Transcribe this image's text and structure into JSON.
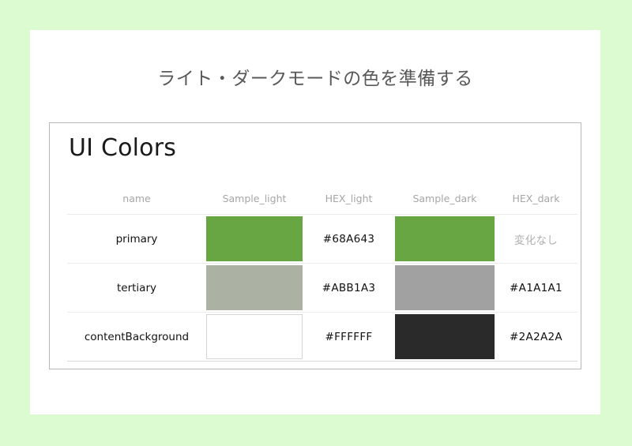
{
  "slide": {
    "title": "ライト・ダークモードの色を準備する",
    "background_color": "#dcfbd0",
    "card_color": "#ffffff"
  },
  "table": {
    "heading": "UI Colors",
    "columns": [
      {
        "key": "name",
        "label": "name"
      },
      {
        "key": "sample_light",
        "label": "Sample_light"
      },
      {
        "key": "hex_light",
        "label": "HEX_light"
      },
      {
        "key": "sample_dark",
        "label": "Sample_dark"
      },
      {
        "key": "hex_dark",
        "label": "HEX_dark"
      }
    ],
    "rows": [
      {
        "name": "primary",
        "sample_light_color": "#68A643",
        "hex_light": "#68A643",
        "sample_dark_color": "#68A643",
        "hex_dark": "変化なし",
        "hex_dark_muted": true,
        "sample_light_outlined": false,
        "sample_dark_outlined": false
      },
      {
        "name": "tertiary",
        "sample_light_color": "#ABB1A3",
        "hex_light": "#ABB1A3",
        "sample_dark_color": "#A1A1A1",
        "hex_dark": "#A1A1A1",
        "hex_dark_muted": false,
        "sample_light_outlined": false,
        "sample_dark_outlined": false
      },
      {
        "name": "contentBackground",
        "sample_light_color": "#FFFFFF",
        "hex_light": "#FFFFFF",
        "sample_dark_color": "#2A2A2A",
        "hex_dark": "#2A2A2A",
        "hex_dark_muted": false,
        "sample_light_outlined": true,
        "sample_dark_outlined": false
      }
    ]
  }
}
